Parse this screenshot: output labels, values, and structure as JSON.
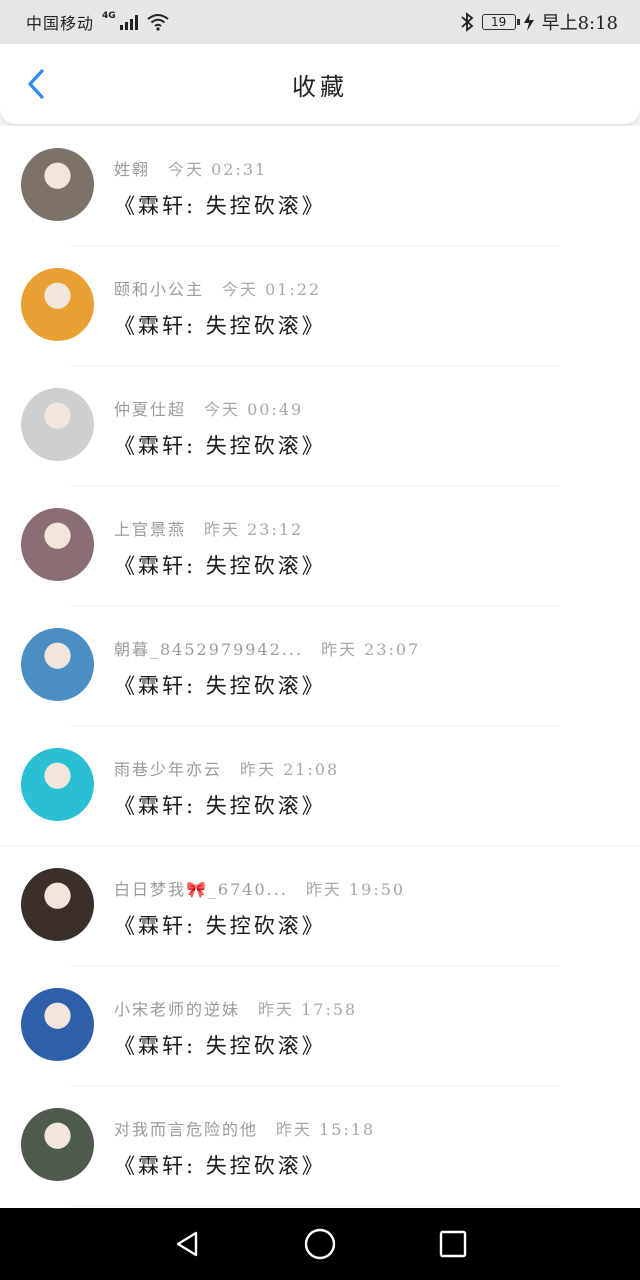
{
  "status_bar": {
    "carrier": "中国移动",
    "network_type": "4G",
    "battery": "19",
    "time": "早上8:18",
    "icons": [
      "signal-icon",
      "wifi-icon",
      "bluetooth-icon",
      "battery-icon",
      "charging-icon"
    ]
  },
  "header": {
    "title": "收藏",
    "back_icon": "chevron-left-icon",
    "accent_color": "#2b8cf0"
  },
  "favorites": [
    {
      "user": "姓翱",
      "time": "今天 02:31",
      "title": "《霖轩: 失控砍滚》",
      "avatar_color": "#7c7266"
    },
    {
      "user": "颐和小公主",
      "time": "今天 01:22",
      "title": "《霖轩: 失控砍滚》",
      "avatar_color": "#e8a033"
    },
    {
      "user": "仲夏仕超",
      "time": "今天 00:49",
      "title": "《霖轩: 失控砍滚》",
      "avatar_color": "#cfcfcf"
    },
    {
      "user": "上官景燕",
      "time": "昨天 23:12",
      "title": "《霖轩: 失控砍滚》",
      "avatar_color": "#8a6e73"
    },
    {
      "user": "朝暮_8452979942...",
      "time": "昨天 23:07",
      "title": "《霖轩: 失控砍滚》",
      "avatar_color": "#4a8ec4"
    },
    {
      "user": "雨巷少年亦云",
      "time": "昨天 21:08",
      "title": "《霖轩: 失控砍滚》",
      "avatar_color": "#2bbfd4"
    },
    {
      "user": "白日梦我🎀_6740...",
      "time": "昨天 19:50",
      "title": "《霖轩: 失控砍滚》",
      "avatar_color": "#3b2f2a"
    },
    {
      "user": "小宋老师的逆妹",
      "time": "昨天 17:58",
      "title": "《霖轩: 失控砍滚》",
      "avatar_color": "#2f5fa8"
    },
    {
      "user": "对我而言危险的他",
      "time": "昨天 15:18",
      "title": "《霖轩: 失控砍滚》",
      "avatar_color": "#4e5a4c"
    }
  ],
  "nav_bar": {
    "icons": [
      "back-triangle-icon",
      "home-circle-icon",
      "recents-square-icon"
    ]
  }
}
